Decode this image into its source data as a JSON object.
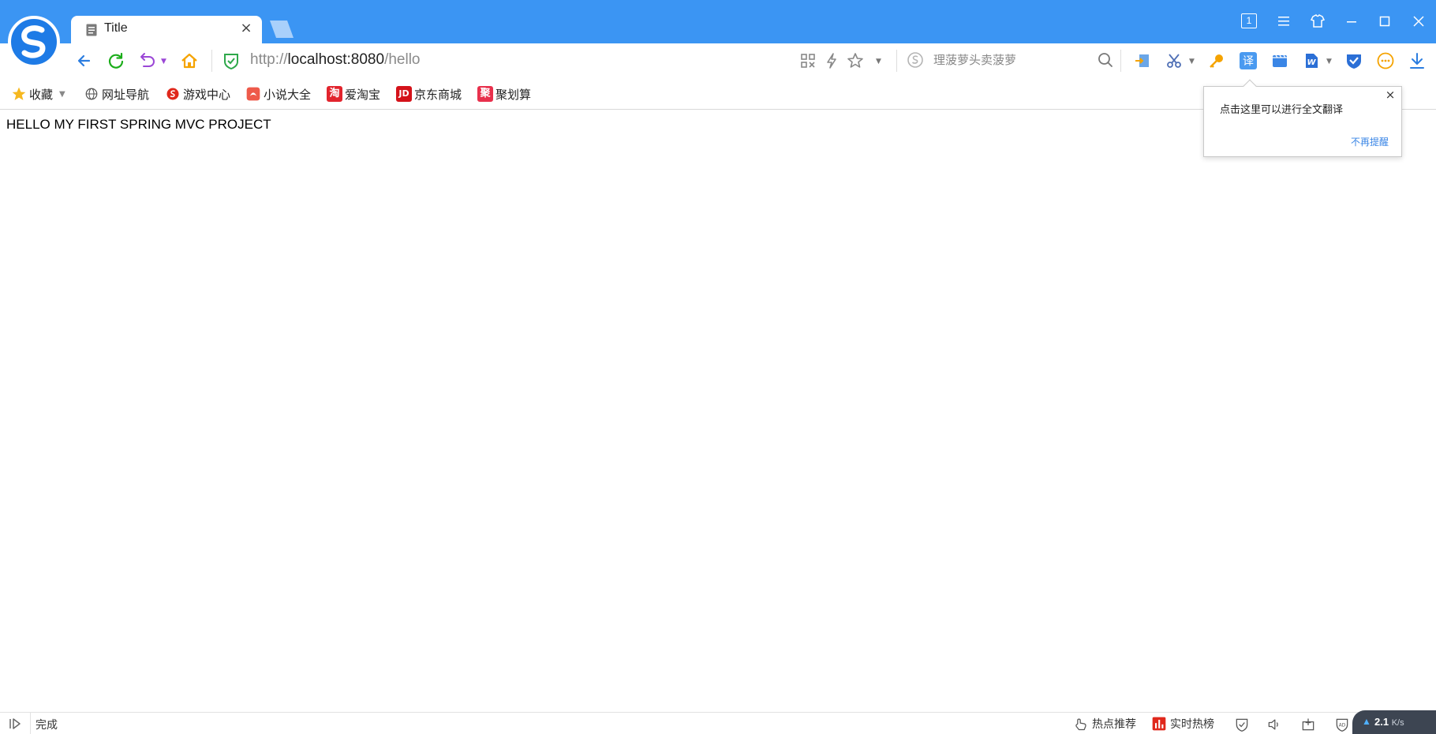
{
  "browser": {
    "tab": {
      "title": "Title"
    },
    "window_badge": "1",
    "address": {
      "scheme": "http://",
      "host": "localhost:8080",
      "path": "/hello"
    },
    "search": {
      "placeholder": "理菠萝头卖菠萝"
    },
    "colors": {
      "accent": "#3b95f3",
      "link": "#3a86e6",
      "refresh": "#1aad19",
      "home": "#f5a300"
    }
  },
  "bookmarks": [
    {
      "label": "收藏",
      "icon": "star-icon"
    },
    {
      "label": "网址导航",
      "icon": "globe-icon"
    },
    {
      "label": "游戏中心",
      "icon": "game-icon"
    },
    {
      "label": "小说大全",
      "icon": "book-icon"
    },
    {
      "label": "爱淘宝",
      "icon": "taobao-icon",
      "glyph": "淘"
    },
    {
      "label": "京东商城",
      "icon": "jd-icon",
      "glyph": "JD"
    },
    {
      "label": "聚划算",
      "icon": "juhuasuan-icon",
      "glyph": "聚"
    }
  ],
  "page": {
    "content": "HELLO MY FIRST SPRING MVC PROJECT"
  },
  "popup": {
    "message": "点击这里可以进行全文翻译",
    "dismiss_link": "不再提醒",
    "close": "×"
  },
  "statusbar": {
    "status": "完成",
    "hot_recommend": "热点推荐",
    "realtime_hot": "实时热榜",
    "speed": "2.1",
    "speed_unit": "K/s"
  },
  "toolbar_icons": [
    "grid-qr-icon",
    "lightning-icon",
    "star-outline-icon",
    "exit-icon",
    "scissors-icon",
    "key-icon",
    "translate-icon",
    "video-icon",
    "word-icon",
    "shield-check-icon",
    "more-icon",
    "download-icon"
  ]
}
